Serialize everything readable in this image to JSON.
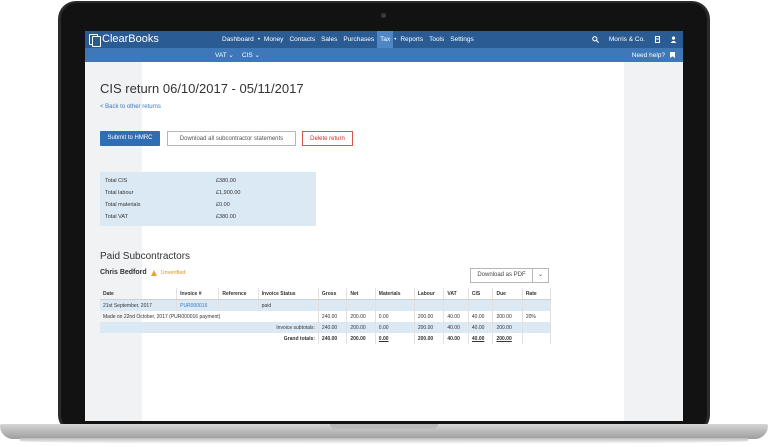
{
  "topbar": {
    "logo": "ClearBooks",
    "nav": [
      "Dashboard",
      "Money",
      "Contacts",
      "Sales",
      "Purchases",
      "Tax",
      "Reports",
      "Tools",
      "Settings"
    ],
    "active_nav": "Tax",
    "company": "Morris & Co."
  },
  "subbar": {
    "items": [
      "VAT",
      "CIS"
    ],
    "help": "Need help?"
  },
  "page": {
    "title": "CIS return 06/10/2017 - 05/11/2017",
    "back_link": "< Back to other returns",
    "buttons": {
      "submit": "Submit to HMRC",
      "download_all": "Download all subcontractor statements",
      "delete": "Delete return"
    }
  },
  "summary": [
    {
      "label": "Total CIS",
      "value": "£380.00"
    },
    {
      "label": "Total labour",
      "value": "£1,900.00"
    },
    {
      "label": "Total materials",
      "value": "£0.00"
    },
    {
      "label": "Total VAT",
      "value": "£380.00"
    }
  ],
  "subcontractors": {
    "section_title": "Paid Subcontractors",
    "name": "Chris Bedford",
    "status": "Unverified",
    "download_pdf": "Download as PDF",
    "table": {
      "headers": [
        "Date",
        "Invoice #",
        "Reference",
        "Invoice Status",
        "Gross",
        "Net",
        "Materials",
        "Labour",
        "VAT",
        "CIS",
        "Due",
        "Rate"
      ],
      "invoice_row": {
        "date": "21st September, 2017",
        "invoice": "PUR000016",
        "reference": "",
        "status": "paid"
      },
      "payment_row": {
        "label": "Made on 22nd October, 2017 (PUR000016 payment)",
        "values": [
          "240.00",
          "200.00",
          "0.00",
          "200.00",
          "40.00",
          "40.00",
          "200.00",
          "20%"
        ]
      },
      "subtotal_row": {
        "label": "Invoice subtotals:",
        "values": [
          "240.00",
          "200.00",
          "0.00",
          "200.00",
          "40.00",
          "40.00",
          "200.00"
        ]
      },
      "grand_row": {
        "label": "Grand totals:",
        "values": [
          "240.00",
          "200.00",
          "0.00",
          "200.00",
          "40.00",
          "40.00",
          "200.00"
        ]
      }
    }
  }
}
